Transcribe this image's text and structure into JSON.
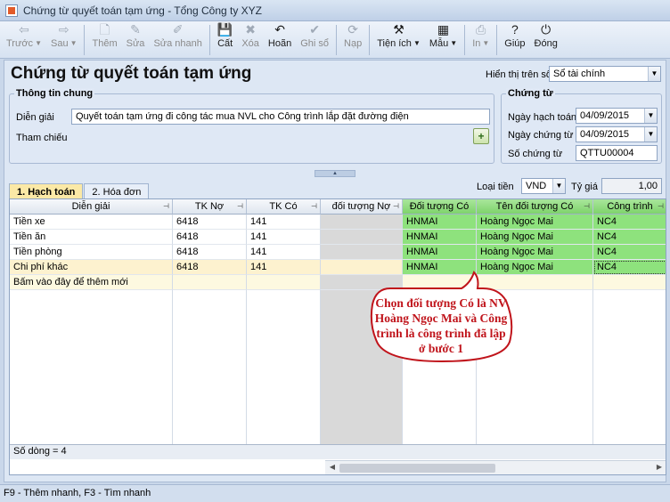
{
  "window": {
    "title": "Chứng từ quyết toán tạm ứng - Tổng Công ty XYZ"
  },
  "toolbar": {
    "buttons": [
      {
        "label": "Trước",
        "icon": "arrow-left-icon",
        "glyph": "⇦",
        "enabled": false,
        "dropdown": true
      },
      {
        "label": "Sau",
        "icon": "arrow-right-icon",
        "glyph": "⇨",
        "enabled": false,
        "dropdown": true
      },
      {
        "label": "Thêm",
        "icon": "add-doc-icon",
        "glyph": "🗋",
        "enabled": false
      },
      {
        "label": "Sửa",
        "icon": "edit-icon",
        "glyph": "✎",
        "enabled": false
      },
      {
        "label": "Sửa nhanh",
        "icon": "quick-edit-icon",
        "glyph": "✐",
        "enabled": false
      },
      {
        "label": "Cất",
        "icon": "save-icon",
        "glyph": "💾",
        "enabled": true
      },
      {
        "label": "Xóa",
        "icon": "delete-icon",
        "glyph": "✖",
        "enabled": false
      },
      {
        "label": "Hoãn",
        "icon": "undo-icon",
        "glyph": "↶",
        "enabled": true
      },
      {
        "label": "Ghi sổ",
        "icon": "post-icon",
        "glyph": "✔",
        "enabled": false
      },
      {
        "label": "Nạp",
        "icon": "reload-icon",
        "glyph": "⟳",
        "enabled": false
      },
      {
        "label": "Tiện ích",
        "icon": "utilities-icon",
        "glyph": "⚒",
        "enabled": true,
        "dropdown": true
      },
      {
        "label": "Mẫu",
        "icon": "template-icon",
        "glyph": "▦",
        "enabled": true,
        "dropdown": true
      },
      {
        "label": "In",
        "icon": "print-icon",
        "glyph": "⎙",
        "enabled": false,
        "dropdown": true
      },
      {
        "label": "Giúp",
        "icon": "help-icon",
        "glyph": "?",
        "enabled": true
      },
      {
        "label": "Đóng",
        "icon": "close-icon",
        "glyph": "⏻",
        "enabled": true
      }
    ]
  },
  "page": {
    "title": "Chứng từ quyết toán tạm ứng",
    "display_label": "Hiển thị trên sổ",
    "display_value": "Sổ tài chính"
  },
  "general_info": {
    "title": "Thông tin chung",
    "description_label": "Diễn giải",
    "description_value": "Quyết toán tạm ứng đi công tác mua NVL cho Công trình lắp đặt đường điện",
    "reference_label": "Tham chiếu"
  },
  "voucher": {
    "title": "Chứng từ",
    "posting_date_label": "Ngày hạch toán",
    "posting_date": "04/09/2015",
    "voucher_date_label": "Ngày chứng từ",
    "voucher_date": "04/09/2015",
    "number_label": "Số chứng từ",
    "number": "QTTU00004"
  },
  "tabs": [
    {
      "label": "1. Hạch toán",
      "active": true
    },
    {
      "label": "2. Hóa đơn",
      "active": false
    }
  ],
  "currency": {
    "label": "Loại tiền",
    "value": "VND",
    "rate_label": "Tỷ giá",
    "rate": "1,00"
  },
  "grid": {
    "columns": [
      "Diễn giải",
      "TK Nợ",
      "TK Có",
      "đối tượng Nợ",
      "Đối tượng Có",
      "Tên đối tượng Có",
      "Công trình"
    ],
    "rows": [
      [
        "Tiền xe",
        "6418",
        "141",
        "",
        "HNMAI",
        "Hoàng Ngọc Mai",
        "NC4"
      ],
      [
        "Tiền ăn",
        "6418",
        "141",
        "",
        "HNMAI",
        "Hoàng Ngọc Mai",
        "NC4"
      ],
      [
        "Tiền phòng",
        "6418",
        "141",
        "",
        "HNMAI",
        "Hoàng Ngọc Mai",
        "NC4"
      ],
      [
        "Chi phí khác",
        "6418",
        "141",
        "",
        "HNMAI",
        "Hoàng Ngọc Mai",
        "NC4"
      ]
    ],
    "add_row_text": "Bấm vào đây để thêm mới",
    "row_count": "Số dòng = 4"
  },
  "callout": {
    "text": "Chọn đối tượng Có là NV Hoàng Ngọc Mai và Công trình là công trình đã lập ở bước 1"
  },
  "statusbar": {
    "text": "F9 - Thêm nhanh, F3 - Tìm nhanh"
  },
  "colors": {
    "accent_green": "#8ee27d",
    "selected_row": "#fdf2cf",
    "callout_red": "#c0141b"
  }
}
